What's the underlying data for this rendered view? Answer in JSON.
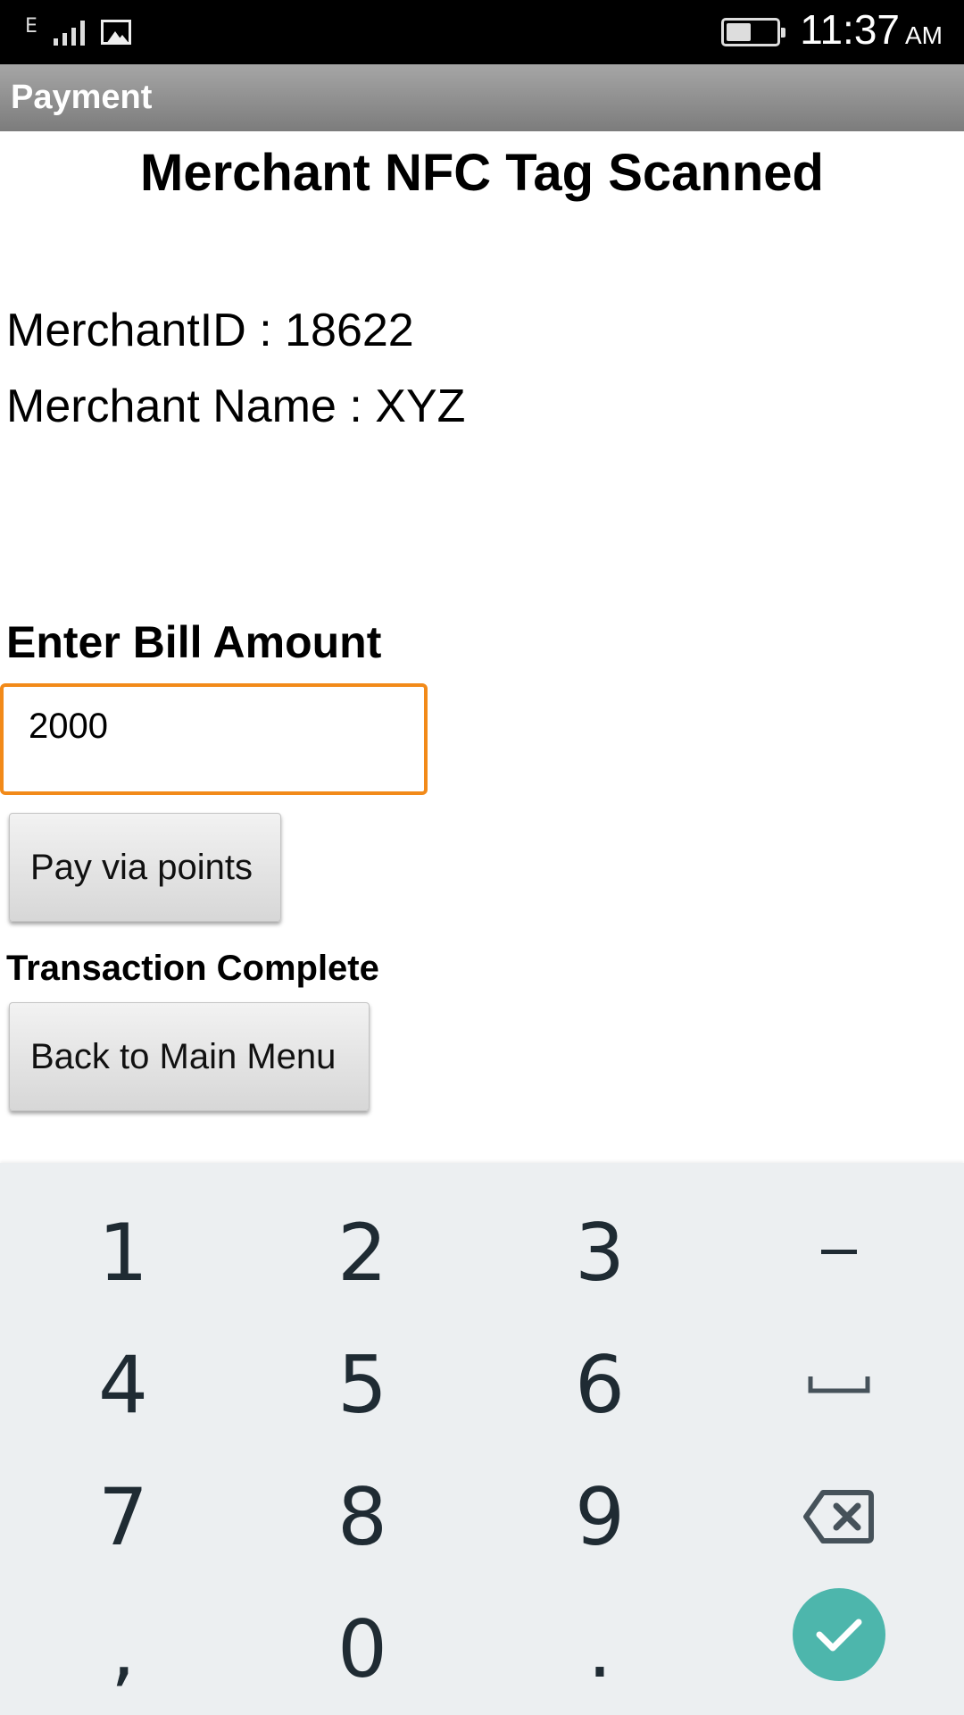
{
  "status_bar": {
    "network_type": "E",
    "time": "11:37",
    "ampm": "AM",
    "battery_level": 0.55
  },
  "app_bar": {
    "title": "Payment"
  },
  "main": {
    "heading": "Merchant NFC Tag Scanned",
    "merchant_id_line": "MerchantID : 18622",
    "merchant_name_line": "Merchant Name :  XYZ",
    "bill_label": "Enter Bill Amount",
    "bill_amount_value": "2000",
    "pay_button_label": "Pay via points",
    "transaction_status": "Transaction Complete",
    "back_button_label": "Back to Main Menu"
  },
  "keypad": {
    "keys": [
      "1",
      "2",
      "3",
      "-",
      "4",
      "5",
      "6",
      "␣",
      "7",
      "8",
      "9",
      "⌫",
      ",",
      "0",
      "."
    ],
    "enter_icon": "checkmark-icon",
    "enter_color": "#4db6ac",
    "focus_color": "#f28a19"
  }
}
